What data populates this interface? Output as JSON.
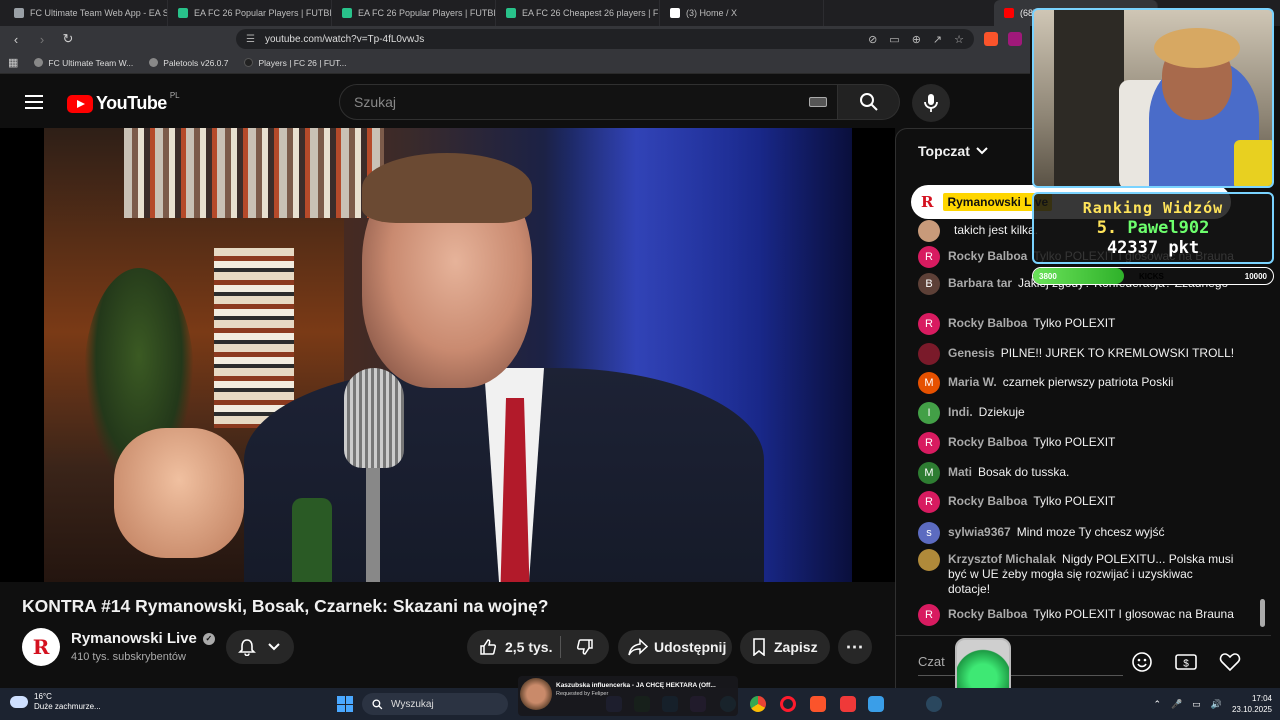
{
  "browser": {
    "tabs": [
      {
        "title": "FC Ultimate Team Web App - EA SPO",
        "icon": "ea-icon",
        "color": "#9aa0a6"
      },
      {
        "title": "EA FC 26 Popular Players | FUTBIN",
        "icon": "futbin-icon",
        "color": "#28c28a"
      },
      {
        "title": "EA FC 26 Popular Players | FUTBIN",
        "icon": "futbin-icon",
        "color": "#28c28a"
      },
      {
        "title": "EA FC 26 Cheapest 26 players | FUTB",
        "icon": "futbin-icon",
        "color": "#28c28a"
      },
      {
        "title": "(3) Home / X",
        "icon": "x-icon",
        "color": "#ffffff"
      },
      {
        "title": "(68) KONTRA #14 Rymanowski",
        "icon": "youtube-icon",
        "color": "#ff0000"
      }
    ],
    "url": "youtube.com/watch?v=Tp-4fL0vwJs",
    "bookmarks": [
      {
        "label": "FC Ultimate Team W..."
      },
      {
        "label": "Paletools v26.0.7"
      },
      {
        "label": "Players | FC 26 | FUT..."
      }
    ]
  },
  "youtube": {
    "logo_text": "YouTube",
    "region": "PL",
    "search_placeholder": "Szukaj"
  },
  "video": {
    "title": "KONTRA #14 Rymanowski, Bosak, Czarnek: Skazani na wojnę?",
    "channel": "Rymanowski Live",
    "channel_initial": "R",
    "subscribers": "410 tys. subskrybentów",
    "likes": "2,5 tys.",
    "share_label": "Udostępnij",
    "save_label": "Zapisz"
  },
  "chat": {
    "header": "Topczat",
    "pinned_author": "Rymanowski Live",
    "input_placeholder": "Czat",
    "messages": [
      {
        "author": "",
        "text": "takich jest kilka.",
        "avatar_color": "#c89a7a",
        "initial": ""
      },
      {
        "author": "Rocky Balboa",
        "text": "Tylko POLEXIT I glosowac na Brauna",
        "avatar_color": "#d81b60",
        "initial": "R"
      },
      {
        "author": "Barbara tar",
        "text": "Jakiej zgody? Konfederacja? Zżadnego",
        "avatar_color": "#5d4037",
        "initial": "B"
      },
      {
        "author": "Rocky Balboa",
        "text": "Tylko POLEXIT",
        "avatar_color": "#d81b60",
        "initial": "R"
      },
      {
        "author": "Genesis",
        "text": "PILNE!! JUREK TO KREMLOWSKI TROLL!",
        "avatar_color": "#7a1a2a",
        "initial": ""
      },
      {
        "author": "Maria W.",
        "text": "czarnek pierwszy patriota Poskii",
        "avatar_color": "#e65100",
        "initial": "M"
      },
      {
        "author": "Indi.",
        "text": "Dziekuje",
        "avatar_color": "#43a047",
        "initial": "I"
      },
      {
        "author": "Rocky Balboa",
        "text": "Tylko POLEXIT",
        "avatar_color": "#d81b60",
        "initial": "R"
      },
      {
        "author": "Mati",
        "text": "Bosak do tusska.",
        "avatar_color": "#2e7d32",
        "initial": "M"
      },
      {
        "author": "Rocky Balboa",
        "text": "Tylko POLEXIT",
        "avatar_color": "#d81b60",
        "initial": "R"
      },
      {
        "author": "sylwia9367",
        "text": "Mind moze Ty chcesz wyjść",
        "avatar_color": "#5c6bc0",
        "initial": "s"
      },
      {
        "author": "Krzysztof Michalak",
        "text": "Nigdy POLEXITU... Polska musi być w UE żeby mogła się rozwijać i uzyskiwac dotacje!",
        "avatar_color": "#b08a3a",
        "initial": ""
      },
      {
        "author": "Rocky Balboa",
        "text": "Tylko POLEXIT I glosowac na Brauna",
        "avatar_color": "#d81b60",
        "initial": "R"
      }
    ]
  },
  "overlay": {
    "ranking_title": "Ranking Widzów",
    "rank_position": "5.",
    "rank_user": "Pawel902",
    "rank_points": "42337 pkt",
    "kicks_current": "3800",
    "kicks_label": "KICKS",
    "kicks_max": "10000",
    "kicks_progress": 0.38
  },
  "taskbar": {
    "weather_temp": "16°C",
    "weather_desc": "Duże zachmurze...",
    "search_label": "Wyszukaj",
    "media_title": "Kaszubska influencerka - JA CHCĘ HEKTARA (Off...",
    "media_sub": "Requested by Feliper",
    "time": "17:04",
    "date": "23.10.2025"
  }
}
